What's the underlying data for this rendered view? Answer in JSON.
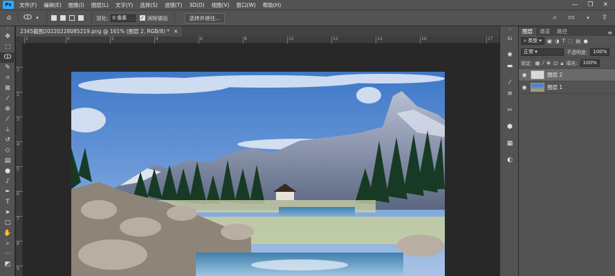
{
  "menubar": {
    "logo": "Ps",
    "items": [
      "文件(F)",
      "编辑(E)",
      "图像(I)",
      "图层(L)",
      "文字(Y)",
      "选择(S)",
      "滤镜(T)",
      "3D(D)",
      "视图(V)",
      "窗口(W)",
      "帮助(H)"
    ],
    "window_buttons": [
      "—",
      "❐",
      "✕"
    ]
  },
  "options": {
    "feather_label": "羽化:",
    "feather_value": "0 像素",
    "antialias_label": "消除锯齿",
    "select_mask_button": "选择并遮住..."
  },
  "document": {
    "tab_title": "2345截图20220228085219.png @ 161% (图层 2, RGB/8) *",
    "ruler_h_ticks": [
      "2",
      "0",
      "2",
      "4",
      "6",
      "8",
      "10",
      "12",
      "14",
      "16",
      "17"
    ],
    "ruler_v_ticks": [
      "1",
      "2",
      "3",
      "4",
      "5",
      "6",
      "7",
      "8",
      "9"
    ]
  },
  "layers_panel": {
    "tabs": [
      "图层",
      "通道",
      "路径"
    ],
    "kind_filter": "类型",
    "blend_mode": "正常",
    "opacity_label": "不透明度:",
    "opacity_value": "100%",
    "lock_label": "锁定:",
    "fill_label": "填充:",
    "fill_value": "100%",
    "layers": [
      {
        "name": "图层 2",
        "selected": true
      },
      {
        "name": "图层 1",
        "selected": false
      }
    ]
  },
  "colors": {
    "ui_dark": "#282828",
    "ui_panel": "#535353",
    "accent_ps": "#31a8ff"
  }
}
